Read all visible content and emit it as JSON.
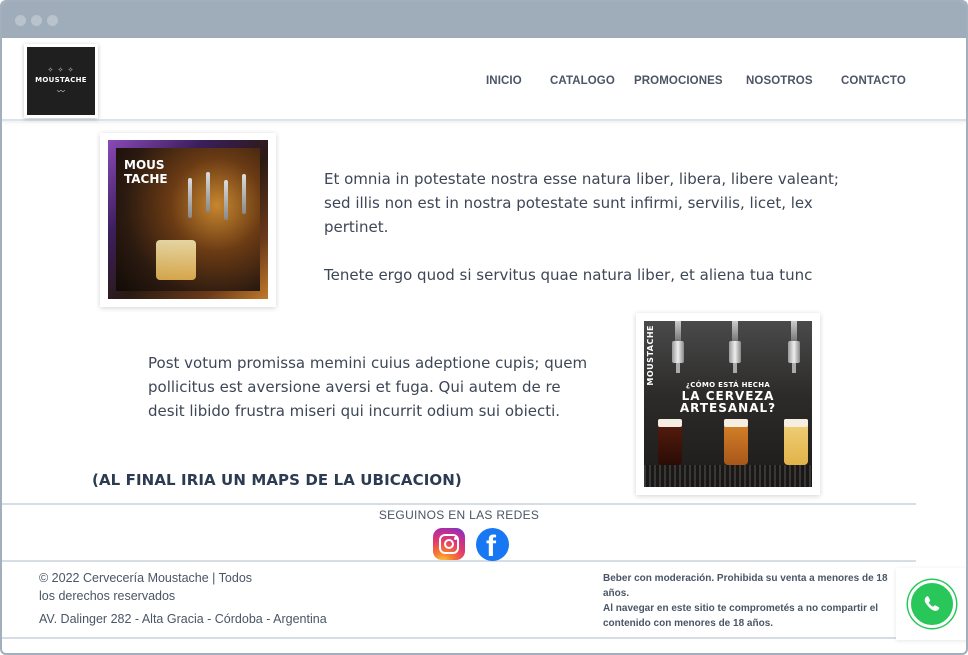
{
  "nav": {
    "items": [
      {
        "label": "INICIO"
      },
      {
        "label": "CATALOGO"
      },
      {
        "label": "PROMOCIONES"
      },
      {
        "label": "NOSOTROS"
      },
      {
        "label": "CONTACTO"
      }
    ]
  },
  "logo": {
    "text": "MOUSTACHE"
  },
  "main": {
    "photo1_badge_line1": "MOUS",
    "photo1_badge_line2": "TACHE",
    "paragraph1": "Et omnia in potestate nostra esse natura liber, libera, libere valeant; sed illis non est in nostra potestate sunt infirmi, servilis, licet, lex pertinet.",
    "paragraph2": "Tenete ergo quod si servitus quae natura liber, et aliena tua tunc",
    "paragraph3": "Post votum promissa memini cuius adeptione cupis; quem pollicitus est aversione aversi et fuga. Qui autem de re desit libido frustra miseri qui incurrit odium sui obiecti.",
    "maps_note": "(AL FINAL IRIA UN MAPS DE LA UBICACION)",
    "photo2_side": "MOUSTACHE",
    "photo2_q1": "¿CÓMO ESTÁ HECHA",
    "photo2_q2": "LA CERVEZA",
    "photo2_q3": "ARTESANAL?"
  },
  "footer": {
    "social_title": "SEGUINOS EN LAS REDES",
    "copyright_line1": "© 2022 Cervecería Moustache | Todos",
    "copyright_line2": "los derechos reservados",
    "address": "AV. Dalinger 282 - Alta Gracia - Córdoba - Argentina",
    "legal_line1": "Beber con moderación. Prohibida su venta a menores de 18 años.",
    "legal_line2": "Al navegar en este sitio te comprometés a no compartir el contenido con menores de 18 años."
  },
  "colors": {
    "titlebar": "#9fadbb",
    "nav_text": "#4b5565",
    "whatsapp": "#29c75a",
    "facebook": "#1877f2"
  },
  "icons": [
    "instagram-icon",
    "facebook-icon",
    "whatsapp-icon"
  ]
}
